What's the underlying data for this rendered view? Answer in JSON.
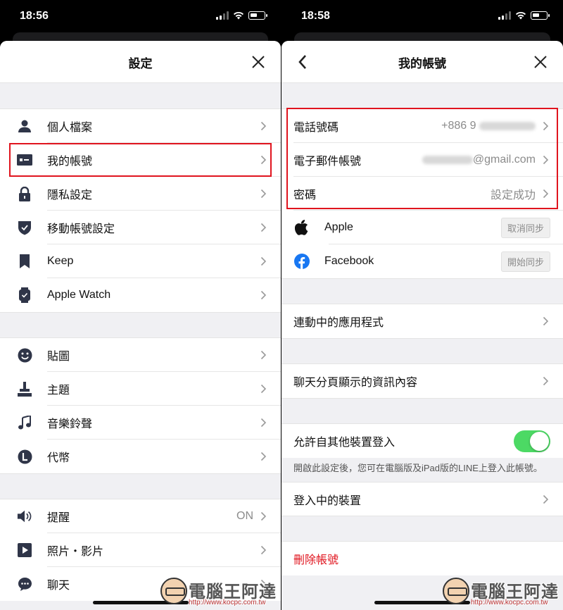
{
  "left": {
    "time": "18:56",
    "title": "設定",
    "groups": [
      [
        {
          "label": "個人檔案",
          "icon": "person-icon"
        },
        {
          "label": "我的帳號",
          "icon": "id-card-icon"
        },
        {
          "label": "隱私設定",
          "icon": "lock-icon"
        },
        {
          "label": "移動帳號設定",
          "icon": "shield-check-icon"
        },
        {
          "label": "Keep",
          "icon": "bookmark-icon"
        },
        {
          "label": "Apple Watch",
          "icon": "watch-icon"
        }
      ],
      [
        {
          "label": "貼圖",
          "icon": "smiley-icon"
        },
        {
          "label": "主題",
          "icon": "brush-icon"
        },
        {
          "label": "音樂鈴聲",
          "icon": "music-note-icon"
        },
        {
          "label": "代幣",
          "icon": "coin-icon"
        }
      ],
      [
        {
          "label": "提醒",
          "icon": "speaker-icon",
          "value": "ON"
        },
        {
          "label": "照片・影片",
          "icon": "play-icon"
        },
        {
          "label": "聊天",
          "icon": "chat-bubble-icon"
        }
      ]
    ]
  },
  "right": {
    "time": "18:58",
    "title": "我的帳號",
    "phone_label": "電話號碼",
    "phone_value": "+886 9",
    "email_label": "電子郵件帳號",
    "email_value": "@gmail.com",
    "password_label": "密碼",
    "password_value": "設定成功",
    "apple_label": "Apple",
    "apple_button": "取消同步",
    "facebook_label": "Facebook",
    "facebook_button": "開始同步",
    "linked_apps": "連動中的應用程式",
    "chat_tab_info": "聊天分頁顯示的資訊內容",
    "allow_login": "允許自其他裝置登入",
    "allow_login_on": true,
    "allow_login_note": "開啟此設定後，您可在電腦版及iPad版的LINE上登入此帳號。",
    "logged_in_devices": "登入中的裝置",
    "delete_account": "刪除帳號"
  },
  "watermark": {
    "brand": "電腦王阿達",
    "url": "http://www.kocpc.com.tw"
  },
  "colors": {
    "highlight": "#e0141e",
    "toggle_on": "#4cd964",
    "danger": "#e0141e",
    "icon": "#2f3548",
    "facebook": "#1877f2"
  }
}
